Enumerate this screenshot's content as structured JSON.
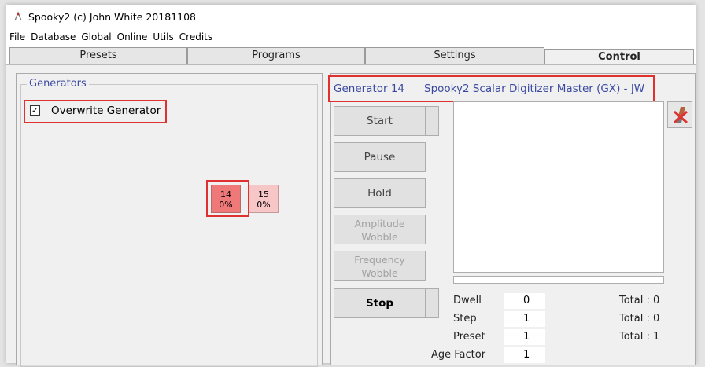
{
  "window": {
    "title": "Spooky2 (c) John White 20181108"
  },
  "menu": [
    "File",
    "Database",
    "Global",
    "Online",
    "Utils",
    "Credits"
  ],
  "tabs": [
    {
      "label": "Presets",
      "active": false
    },
    {
      "label": "Programs",
      "active": false
    },
    {
      "label": "Settings",
      "active": false
    },
    {
      "label": "Control",
      "active": true
    }
  ],
  "generators_panel": {
    "legend": "Generators",
    "overwrite_label": "Overwrite Generator",
    "overwrite_checked": true,
    "generators": [
      {
        "id": "14",
        "progress": "0%",
        "selected": true
      },
      {
        "id": "15",
        "progress": "0%",
        "selected": false
      }
    ]
  },
  "control_panel": {
    "generator_number": "Generator 14",
    "generator_name": "Spooky2 Scalar Digitizer Master (GX) - JW",
    "buttons": {
      "start": "Start",
      "pause": "Pause",
      "hold": "Hold",
      "amplitude_wobble_1": "Amplitude",
      "amplitude_wobble_2": "Wobble",
      "frequency_wobble_1": "Frequency",
      "frequency_wobble_2": "Wobble",
      "stop": "Stop"
    },
    "stats": [
      {
        "label": "Dwell",
        "value": "0",
        "total": "Total : 0"
      },
      {
        "label": "Step",
        "value": "1",
        "total": "Total : 0"
      },
      {
        "label": "Preset",
        "value": "1",
        "total": "Total : 1"
      },
      {
        "label": "Age Factor",
        "value": "1",
        "total": ""
      }
    ]
  },
  "colors": {
    "highlight": "#e03131",
    "legend_text": "#3b4aa0",
    "gen14": "#ef7878",
    "gen15": "#f7c7c7"
  }
}
